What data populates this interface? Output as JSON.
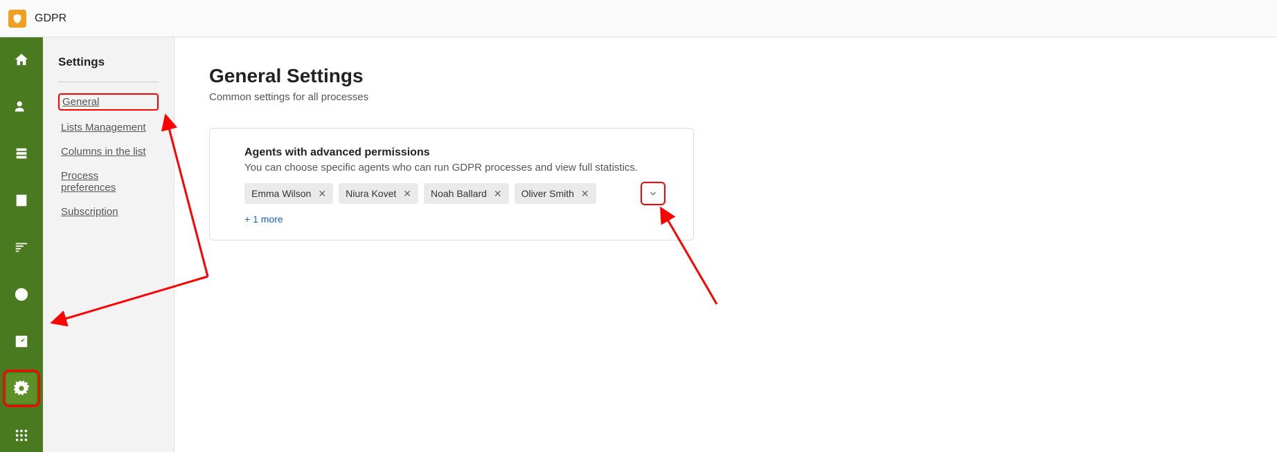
{
  "header": {
    "app_title": "GDPR"
  },
  "rail": {
    "items": [
      {
        "name": "home-icon"
      },
      {
        "name": "users-icon"
      },
      {
        "name": "list-icon"
      },
      {
        "name": "board-icon"
      },
      {
        "name": "queue-icon"
      },
      {
        "name": "clock-icon"
      },
      {
        "name": "chart-icon"
      },
      {
        "name": "gear-icon"
      },
      {
        "name": "apps-icon"
      }
    ]
  },
  "sidebar": {
    "title": "Settings",
    "items": [
      {
        "label": "General"
      },
      {
        "label": "Lists Management"
      },
      {
        "label": "Columns in the list"
      },
      {
        "label": "Process preferences"
      },
      {
        "label": "Subscription"
      }
    ]
  },
  "page": {
    "title": "General Settings",
    "subtitle": "Common settings for all processes"
  },
  "card": {
    "title": "Agents with advanced permissions",
    "desc": "You can choose specific agents who can run GDPR processes and view full statistics.",
    "agents": [
      {
        "name": "Emma Wilson"
      },
      {
        "name": "Niura Kovet"
      },
      {
        "name": "Noah Ballard"
      },
      {
        "name": "Oliver Smith"
      }
    ],
    "more": "+ 1 more"
  }
}
